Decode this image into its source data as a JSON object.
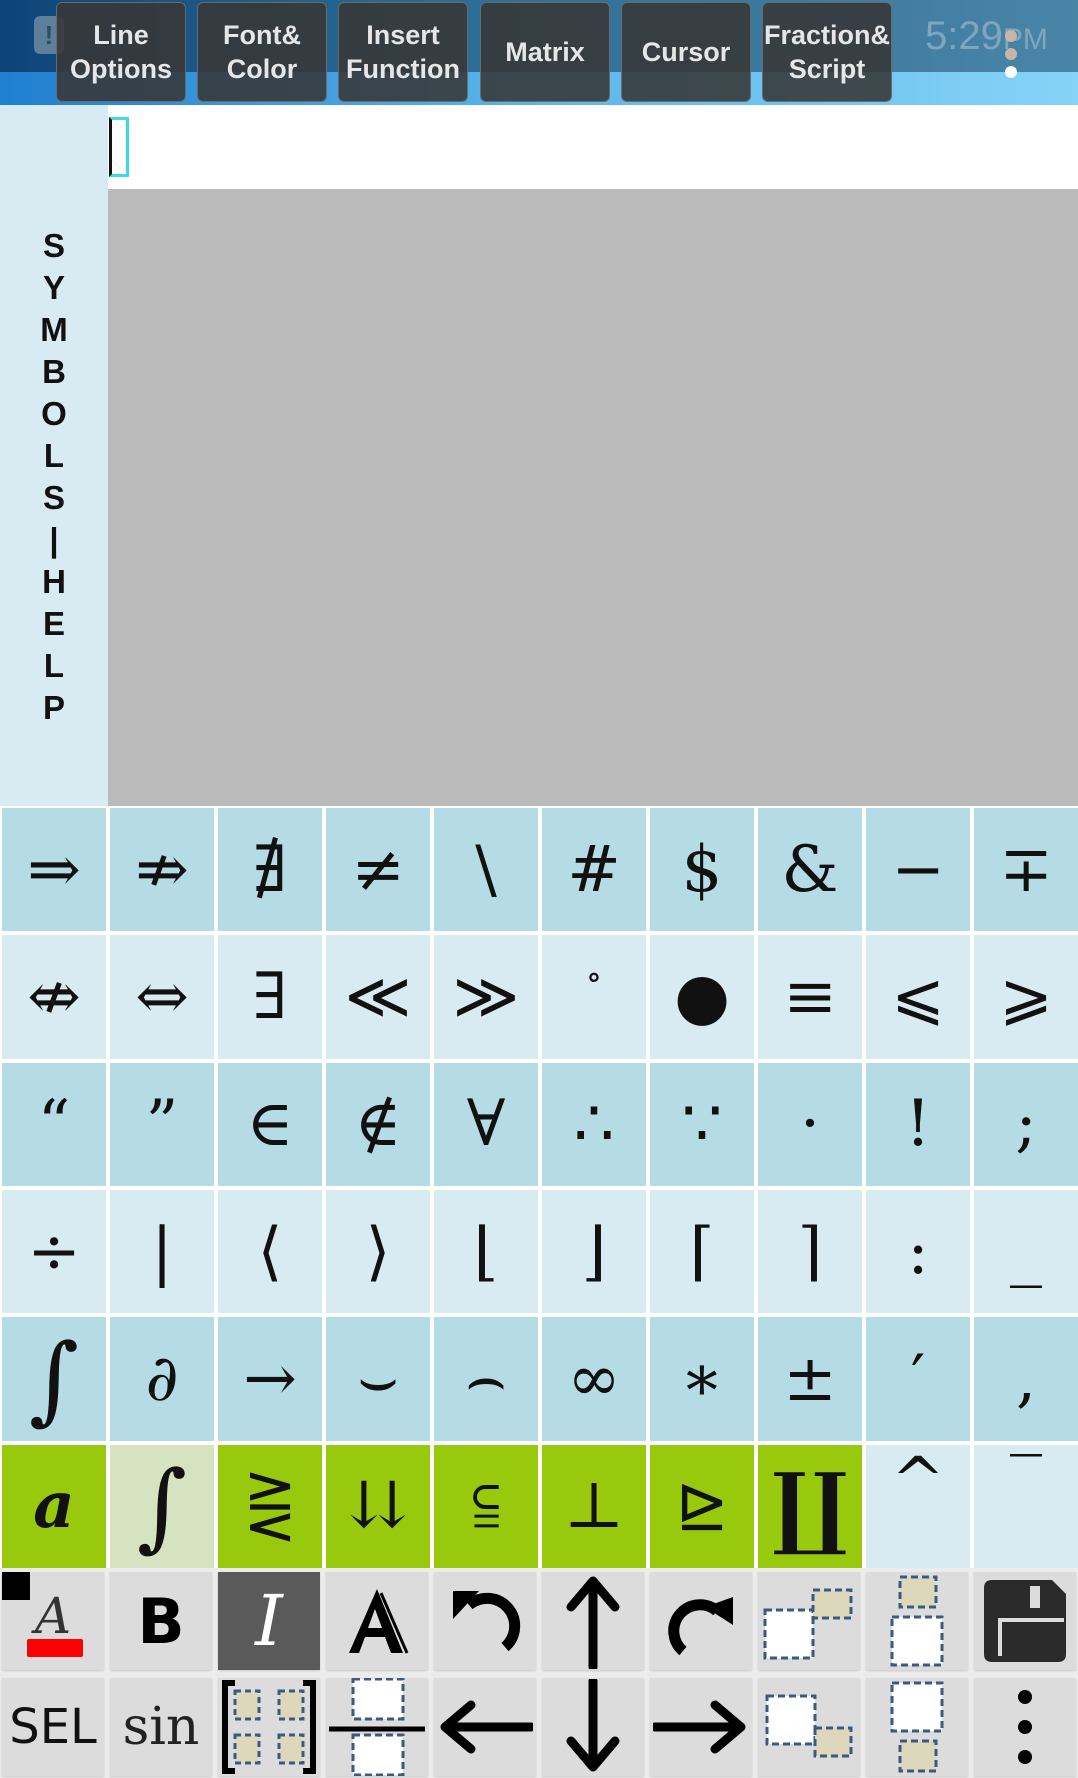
{
  "status_bar": {
    "time": "5:29",
    "ampm": "PM"
  },
  "menu": {
    "buttons": [
      {
        "id": "line-options",
        "label": "Line\nOptions"
      },
      {
        "id": "font-color",
        "label": "Font&\nColor"
      },
      {
        "id": "insert-function",
        "label": "Insert\nFunction"
      },
      {
        "id": "matrix",
        "label": "Matrix"
      },
      {
        "id": "cursor",
        "label": "Cursor"
      },
      {
        "id": "fraction-script",
        "label": "Fraction&\nScript"
      }
    ]
  },
  "sidebar": {
    "label_letters": [
      "S",
      "Y",
      "M",
      "B",
      "O",
      "L",
      "S",
      "|",
      "H",
      "E",
      "L",
      "P"
    ],
    "label": "SYMBOLS | HELP"
  },
  "editor": {
    "content": ""
  },
  "symbol_grid": {
    "rows": [
      {
        "shade": "dark",
        "cells": [
          {
            "name": "implies",
            "glyph": "⇒"
          },
          {
            "name": "not-implies",
            "glyph": "⇏"
          },
          {
            "name": "not-exists",
            "glyph": "∄"
          },
          {
            "name": "not-equal",
            "glyph": "≠"
          },
          {
            "name": "backslash",
            "glyph": "\\"
          },
          {
            "name": "hash",
            "glyph": "#"
          },
          {
            "name": "dollar",
            "glyph": "$"
          },
          {
            "name": "ampersand",
            "glyph": "&"
          },
          {
            "name": "minus",
            "glyph": "−"
          },
          {
            "name": "minus-plus",
            "glyph": "∓"
          }
        ]
      },
      {
        "shade": "light",
        "cells": [
          {
            "name": "not-iff",
            "glyph": "⇎"
          },
          {
            "name": "iff",
            "glyph": "⇔"
          },
          {
            "name": "exists",
            "glyph": "∃"
          },
          {
            "name": "much-less-than",
            "glyph": "≪"
          },
          {
            "name": "much-greater-than",
            "glyph": "≫"
          },
          {
            "name": "degree",
            "glyph": "∘"
          },
          {
            "name": "bullet",
            "glyph": "●"
          },
          {
            "name": "equivalent",
            "glyph": "≡"
          },
          {
            "name": "less-equal-slant",
            "glyph": "⩽"
          },
          {
            "name": "greater-equal-slant",
            "glyph": "⩾"
          }
        ]
      },
      {
        "shade": "dark",
        "cells": [
          {
            "name": "open-quote",
            "glyph": "“"
          },
          {
            "name": "close-quote",
            "glyph": "”"
          },
          {
            "name": "element-of",
            "glyph": "∈"
          },
          {
            "name": "not-element-of",
            "glyph": "∉"
          },
          {
            "name": "for-all",
            "glyph": "∀"
          },
          {
            "name": "therefore",
            "glyph": "∴"
          },
          {
            "name": "because",
            "glyph": "∵"
          },
          {
            "name": "dot",
            "glyph": "·"
          },
          {
            "name": "exclamation",
            "glyph": "!"
          },
          {
            "name": "semicolon",
            "glyph": ";"
          }
        ]
      },
      {
        "shade": "light",
        "cells": [
          {
            "name": "divide",
            "glyph": "÷"
          },
          {
            "name": "vertical-bar",
            "glyph": "|"
          },
          {
            "name": "left-angle",
            "glyph": "⟨"
          },
          {
            "name": "right-angle",
            "glyph": "⟩"
          },
          {
            "name": "left-floor",
            "glyph": "⌊"
          },
          {
            "name": "right-floor",
            "glyph": "⌋"
          },
          {
            "name": "left-ceil",
            "glyph": "⌈"
          },
          {
            "name": "right-ceil",
            "glyph": "⌉"
          },
          {
            "name": "colon",
            "glyph": ":"
          },
          {
            "name": "underscore",
            "glyph": "_"
          }
        ]
      },
      {
        "shade": "dark",
        "cells": [
          {
            "name": "integral",
            "glyph": "∫"
          },
          {
            "name": "partial",
            "glyph": "∂"
          },
          {
            "name": "right-arrow",
            "glyph": "→"
          },
          {
            "name": "smile",
            "glyph": "⌣"
          },
          {
            "name": "frown",
            "glyph": "⌢"
          },
          {
            "name": "infinity",
            "glyph": "∞"
          },
          {
            "name": "asterisk",
            "glyph": "∗"
          },
          {
            "name": "plus-minus",
            "glyph": "±"
          },
          {
            "name": "prime",
            "glyph": "′"
          },
          {
            "name": "comma",
            "glyph": ","
          }
        ]
      },
      {
        "shade": "light",
        "cells": [
          {
            "name": "category-bold-a",
            "glyph": "𝒂",
            "style": "green"
          },
          {
            "name": "category-integrals",
            "glyph": "∫",
            "style": "green-pale"
          },
          {
            "name": "category-relations",
            "glyph": "⋛",
            "style": "green"
          },
          {
            "name": "category-arrows",
            "glyph": "⇊",
            "style": "green"
          },
          {
            "name": "category-sets",
            "glyph": "⫅",
            "style": "green"
          },
          {
            "name": "category-perp",
            "glyph": "⊥",
            "style": "green"
          },
          {
            "name": "category-triangle",
            "glyph": "⊵",
            "style": "green"
          },
          {
            "name": "category-big-operators",
            "glyph": "∐",
            "style": "green"
          },
          {
            "name": "hat",
            "glyph": "^"
          },
          {
            "name": "overline",
            "glyph": "‾"
          }
        ]
      }
    ]
  },
  "toolbar": {
    "row1": [
      {
        "name": "text-color-button",
        "icon": "text-color-icon",
        "color": "#ff0000"
      },
      {
        "name": "bold-button",
        "label": "B"
      },
      {
        "name": "italic-button",
        "label": "I",
        "active": true
      },
      {
        "name": "blackboard-font-button",
        "label": "A"
      },
      {
        "name": "undo-button",
        "icon": "undo-icon"
      },
      {
        "name": "cursor-up-button",
        "icon": "arrow-up-icon"
      },
      {
        "name": "redo-button",
        "icon": "redo-icon"
      },
      {
        "name": "superscript-button",
        "icon": "superscript-icon"
      },
      {
        "name": "overscript-button",
        "icon": "overscript-icon"
      },
      {
        "name": "save-button",
        "icon": "save-icon"
      }
    ],
    "row2": [
      {
        "name": "select-button",
        "label": "SEL"
      },
      {
        "name": "function-button",
        "label": "sin"
      },
      {
        "name": "matrix-button",
        "icon": "matrix-icon"
      },
      {
        "name": "fraction-button",
        "icon": "fraction-icon"
      },
      {
        "name": "cursor-left-button",
        "icon": "arrow-left-icon"
      },
      {
        "name": "cursor-down-button",
        "icon": "arrow-down-icon"
      },
      {
        "name": "cursor-right-button",
        "icon": "arrow-right-icon"
      },
      {
        "name": "subscript-button",
        "icon": "subscript-icon"
      },
      {
        "name": "underscript-button",
        "icon": "underscript-icon"
      },
      {
        "name": "more-options-button",
        "icon": "overflow-menu-icon"
      }
    ]
  },
  "colors": {
    "grid_dark": "#b5dce4",
    "grid_light": "#d8ebf1",
    "category_green": "#99c90c",
    "category_green_pale": "#d5e3c0",
    "canvas": "#bababa",
    "cursor_outline": "#3fd9e6",
    "text_color_current": "#ff0000"
  }
}
